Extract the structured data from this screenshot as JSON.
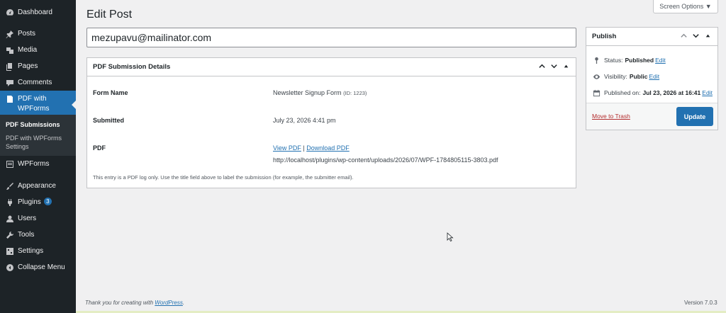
{
  "sidebar": {
    "items": [
      {
        "label": "Dashboard",
        "icon": "dashboard-icon"
      },
      {
        "label": "Posts",
        "icon": "pushpin-icon"
      },
      {
        "label": "Media",
        "icon": "media-icon"
      },
      {
        "label": "Pages",
        "icon": "pages-icon"
      },
      {
        "label": "Comments",
        "icon": "comment-icon"
      },
      {
        "label": "PDF with WPForms",
        "icon": "pdf-icon"
      },
      {
        "label": "WPForms",
        "icon": "wpforms-icon"
      },
      {
        "label": "Appearance",
        "icon": "brush-icon"
      },
      {
        "label": "Plugins",
        "icon": "plugin-icon",
        "badge": "3"
      },
      {
        "label": "Users",
        "icon": "user-icon"
      },
      {
        "label": "Tools",
        "icon": "wrench-icon"
      },
      {
        "label": "Settings",
        "icon": "settings-icon"
      },
      {
        "label": "Collapse Menu",
        "icon": "collapse-icon"
      }
    ],
    "submenu": [
      {
        "label": "PDF Submissions"
      },
      {
        "label": "PDF with WPForms Settings"
      }
    ]
  },
  "header": {
    "screen_options": "Screen Options ▼",
    "page_title": "Edit Post"
  },
  "post": {
    "title_value": "mezupavu@mailinator.com"
  },
  "details": {
    "heading": "PDF Submission Details",
    "form_name_label": "Form Name",
    "form_name_value": "Newsletter Signup Form",
    "form_id": "(ID: 1223)",
    "submitted_label": "Submitted",
    "submitted_value": "July 23, 2026 4:41 pm",
    "pdf_label": "PDF",
    "view_pdf": "View PDF",
    "separator": "|",
    "download_pdf": "Download PDF",
    "pdf_url": "http://localhost/plugins/wp-content/uploads/2026/07/WPF-1784805115-3803.pdf",
    "note": "This entry is a PDF log only. Use the title field above to label the submission (for example, the submitter email)."
  },
  "publish": {
    "heading": "Publish",
    "status_label": "Status:",
    "status_value": "Published",
    "visibility_label": "Visibility:",
    "visibility_value": "Public",
    "published_label": "Published on:",
    "published_value": "Jul 23, 2026 at 16:41",
    "edit": "Edit",
    "trash": "Move to Trash",
    "update": "Update"
  },
  "footer": {
    "thanks_prefix": "Thank you for creating with",
    "thanks_link": "WordPress",
    "thanks_suffix": ".",
    "version": "Version 7.0.3"
  },
  "colors": {
    "sidebar_bg": "#1d2327",
    "accent": "#2271b1",
    "danger": "#b32d2e"
  }
}
